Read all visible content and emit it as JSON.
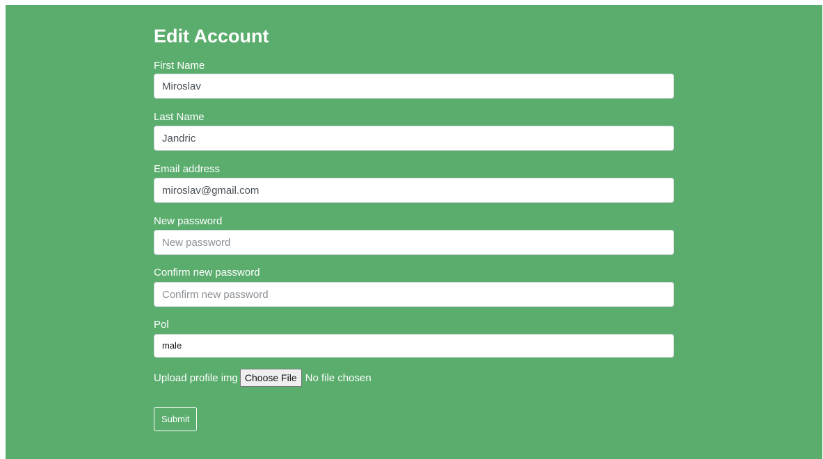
{
  "page": {
    "title": "Edit Account"
  },
  "form": {
    "first_name": {
      "label": "First Name",
      "value": "Miroslav",
      "placeholder": ""
    },
    "last_name": {
      "label": "Last Name",
      "value": "Jandric",
      "placeholder": ""
    },
    "email": {
      "label": "Email address",
      "value": "miroslav@gmail.com",
      "placeholder": ""
    },
    "new_password": {
      "label": "New password",
      "value": "",
      "placeholder": "New password"
    },
    "confirm_password": {
      "label": "Confirm new password",
      "value": "",
      "placeholder": "Confirm new password"
    },
    "gender": {
      "label": "Pol",
      "selected": "male"
    },
    "upload": {
      "label": "Upload profile img",
      "button_label": "Choose File",
      "status": "No file chosen"
    },
    "submit_label": "Submit"
  },
  "colors": {
    "panel_background": "#5bad6e",
    "text": "#ffffff",
    "input_background": "#ffffff"
  }
}
